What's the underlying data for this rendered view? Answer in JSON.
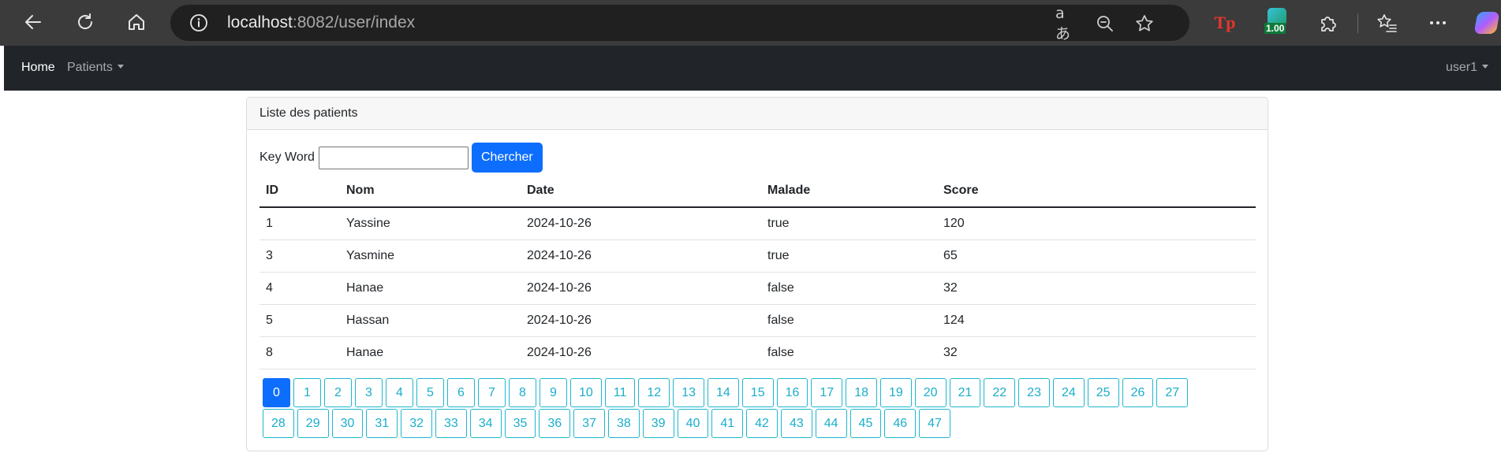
{
  "browser": {
    "url_host": "localhost",
    "url_rest": ":8082/user/index",
    "extension_badge": "1.00"
  },
  "navbar": {
    "home_label": "Home",
    "patients_label": "Patients",
    "user_label": "user1"
  },
  "card": {
    "title": "Liste des patients",
    "search_label": "Key Word",
    "search_value": "",
    "search_button": "Chercher"
  },
  "table": {
    "headers": [
      "ID",
      "Nom",
      "Date",
      "Malade",
      "Score"
    ],
    "rows": [
      [
        "1",
        "Yassine",
        "2024-10-26",
        "true",
        "120"
      ],
      [
        "3",
        "Yasmine",
        "2024-10-26",
        "true",
        "65"
      ],
      [
        "4",
        "Hanae",
        "2024-10-26",
        "false",
        "32"
      ],
      [
        "5",
        "Hassan",
        "2024-10-26",
        "false",
        "124"
      ],
      [
        "8",
        "Hanae",
        "2024-10-26",
        "false",
        "32"
      ]
    ]
  },
  "pagination": {
    "active_page": 0,
    "pages_row1": [
      "0",
      "1",
      "2",
      "3",
      "4",
      "5",
      "6",
      "7",
      "8",
      "9",
      "10",
      "11",
      "12",
      "13",
      "14",
      "15",
      "16",
      "17",
      "18",
      "19",
      "20",
      "21",
      "22",
      "23",
      "24",
      "25",
      "26",
      "27"
    ],
    "pages_row2": [
      "28",
      "29",
      "30",
      "31",
      "32",
      "33",
      "34",
      "35",
      "36",
      "37",
      "38",
      "39",
      "40",
      "41",
      "42",
      "43",
      "44",
      "45",
      "46",
      "47"
    ]
  },
  "colors": {
    "primary": "#0d6efd",
    "navbar_bg": "#212529",
    "pagination_border": "#1fb6cf"
  }
}
